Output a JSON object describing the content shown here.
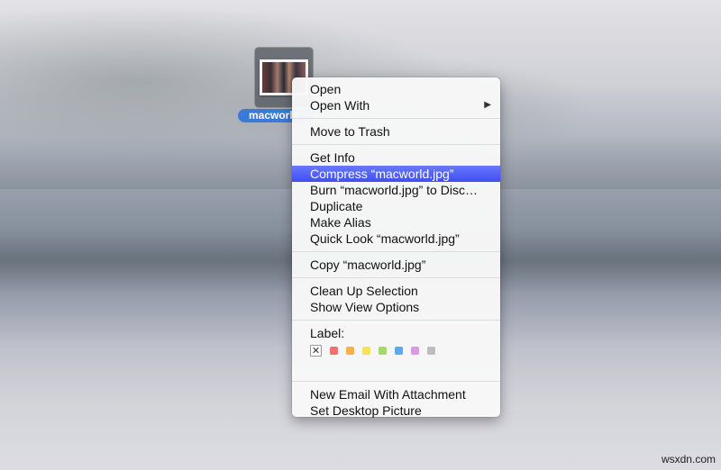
{
  "desktop": {
    "file": {
      "name_label": "macworld",
      "icon": "jpeg-thumbnail-icon"
    },
    "watermark": "wsxdn.com"
  },
  "context_menu": {
    "groups": [
      [
        {
          "label": "Open"
        },
        {
          "label": "Open With",
          "submenu": true,
          "submenu_icon": "▶"
        }
      ],
      [
        {
          "label": "Move to Trash"
        }
      ],
      [
        {
          "label": "Get Info"
        },
        {
          "label": "Compress “macworld.jpg”",
          "highlighted": true
        },
        {
          "label": "Burn “macworld.jpg” to Disc…"
        },
        {
          "label": "Duplicate"
        },
        {
          "label": "Make Alias"
        },
        {
          "label": "Quick Look “macworld.jpg”"
        }
      ],
      [
        {
          "label": "Copy “macworld.jpg”"
        }
      ],
      [
        {
          "label": "Clean Up Selection"
        },
        {
          "label": "Show View Options"
        }
      ]
    ],
    "label_section": {
      "title": "Label:",
      "none_glyph": "✕",
      "colors": [
        {
          "name": "red",
          "hex": "#f07070"
        },
        {
          "name": "orange",
          "hex": "#f5b04c"
        },
        {
          "name": "yellow",
          "hex": "#f3e35a"
        },
        {
          "name": "green",
          "hex": "#a6d86a"
        },
        {
          "name": "blue",
          "hex": "#5fa8f0"
        },
        {
          "name": "purple",
          "hex": "#d79be6"
        },
        {
          "name": "gray",
          "hex": "#bdbdbd"
        }
      ]
    },
    "bottom_group": [
      {
        "label": "New Email With Attachment"
      },
      {
        "label": "Set Desktop Picture"
      }
    ],
    "highlight_color": "#4a58f2"
  }
}
